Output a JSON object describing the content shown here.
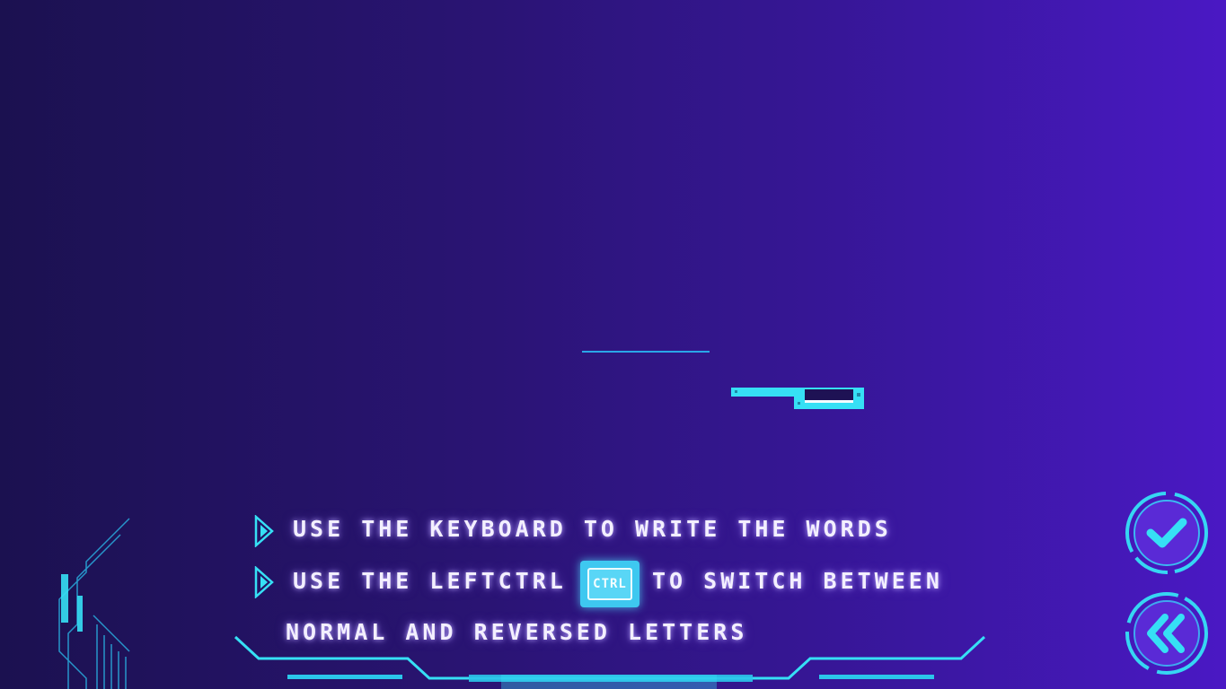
{
  "instructions": {
    "line1": "USE THE KEYBOARD  TO  WRITE  THE  WORDS",
    "line2_before": "USE THE LEFTCTRL",
    "ctrl_key_label": "CTRL",
    "line2_after": "TO SWITCH BETWEEN",
    "line3": "NORMAL AND REVERSED LETTERS"
  },
  "buttons": {
    "confirm_icon": "check-icon",
    "back_icon": "double-chevron-left-icon"
  },
  "colors": {
    "accent_cyan": "#36e0f5",
    "text_glow": "#f3efff",
    "background_left": "#1b1150",
    "background_right": "#4a18c4"
  }
}
